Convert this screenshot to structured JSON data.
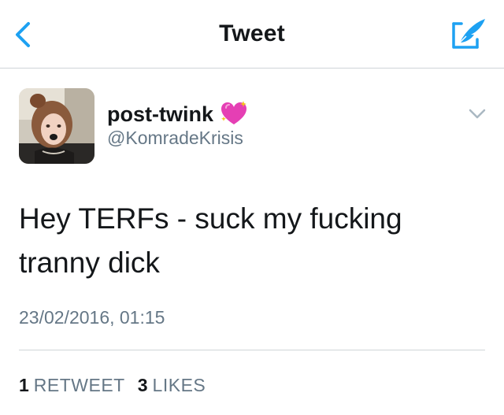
{
  "nav": {
    "title": "Tweet",
    "back_icon": "chevron-left-icon",
    "compose_icon": "compose-tweet-icon",
    "accent": "#1da1f2"
  },
  "author": {
    "display_name": "post-twink",
    "name_emoji": "sparkling-heart-icon",
    "handle": "@KomradeKrisis"
  },
  "tweet": {
    "lines": [
      "Hey TERFs - suck my fucking",
      "tranny dick"
    ],
    "timestamp": "23/02/2016, 01:15"
  },
  "stats": {
    "retweets_count": "1",
    "retweets_label": "RETWEET",
    "likes_count": "3",
    "likes_label": "LIKES"
  },
  "colors": {
    "text": "#14171a",
    "secondary": "#657786",
    "divider": "#cfd4d8"
  }
}
